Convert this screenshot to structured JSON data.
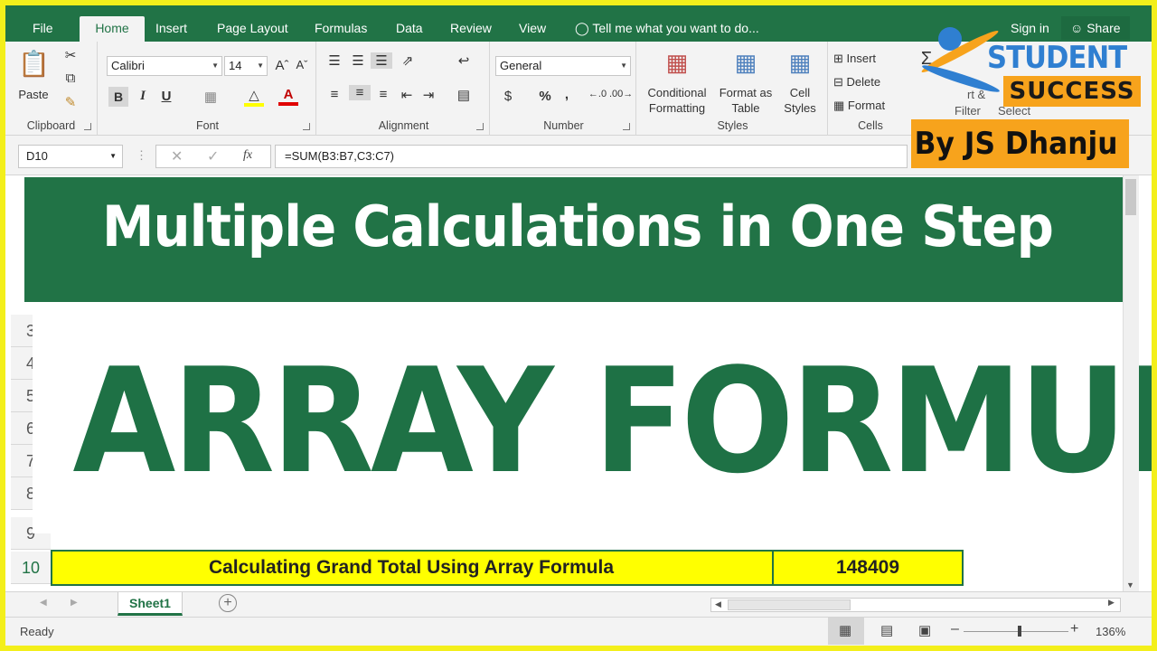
{
  "ribbon_tabs": [
    "File",
    "Home",
    "Insert",
    "Page Layout",
    "Formulas",
    "Data",
    "Review",
    "View"
  ],
  "tell_me": "Tell me what you want to do...",
  "sign_in": "Sign in",
  "share": "Share",
  "clipboard": {
    "paste": "Paste",
    "label": "Clipboard"
  },
  "font": {
    "name": "Calibri",
    "size": "14",
    "label": "Font",
    "bold": "B",
    "italic": "I",
    "underline": "U"
  },
  "alignment": {
    "label": "Alignment"
  },
  "number": {
    "format": "General",
    "label": "Number",
    "currency": "$",
    "percent": "%",
    "comma": ","
  },
  "styles": {
    "conditional": "Conditional",
    "conditional2": "Formatting",
    "format_as": "Format as",
    "format_as2": "Table",
    "cell": "Cell",
    "cell2": "Styles",
    "label": "Styles"
  },
  "cells": {
    "insert": "Insert",
    "delete": "Delete",
    "format": "Format",
    "label": "Cells"
  },
  "editing": {
    "sort_filter": "rt &",
    "filter": "Filter",
    "select": "Select"
  },
  "name_box": "D10",
  "formula": "=SUM(B3:B7,C3:C7)",
  "banner_title": "Multiple Calculations in One Step",
  "array_title": "ARRAY FORMULA",
  "row_numbers": [
    "3",
    "4",
    "5",
    "6",
    "7",
    "8",
    "9",
    "10"
  ],
  "yellow_row": {
    "label": "Calculating Grand Total Using Array Formula",
    "value": "148409"
  },
  "sheet_tab": "Sheet1",
  "status_text": "Ready",
  "zoom": "136%",
  "logo": {
    "line1": "STUDENT",
    "line2": "SUCCESS",
    "byline": "By JS Dhanju"
  },
  "colors": {
    "excel_green": "#217346",
    "highlight": "#ffff00",
    "frame": "#f3ef1b",
    "logo_orange": "#f7a31c",
    "logo_blue": "#2f7fd1"
  }
}
